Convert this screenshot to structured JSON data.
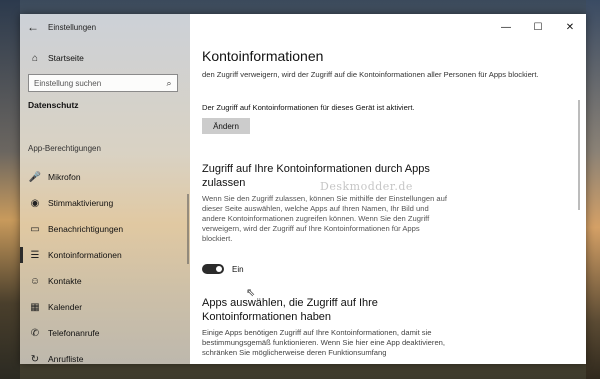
{
  "window": {
    "app_title": "Einstellungen",
    "back_icon": "←",
    "caption": {
      "minimize": "—",
      "maximize": "☐",
      "close": "✕"
    }
  },
  "sidebar": {
    "home": {
      "icon": "⌂",
      "label": "Startseite"
    },
    "search": {
      "placeholder": "Einstellung suchen",
      "icon": "⌕"
    },
    "section_title": "Datenschutz",
    "group_header": "App-Berechtigungen",
    "items": [
      {
        "icon": "🎤",
        "label": "Mikrofon"
      },
      {
        "icon": "◉",
        "label": "Stimmaktivierung"
      },
      {
        "icon": "▭",
        "label": "Benachrichtigungen"
      },
      {
        "icon": "☰",
        "label": "Kontoinformationen",
        "selected": true
      },
      {
        "icon": "☺",
        "label": "Kontakte"
      },
      {
        "icon": "▦",
        "label": "Kalender"
      },
      {
        "icon": "✆",
        "label": "Telefonanrufe"
      },
      {
        "icon": "↻",
        "label": "Anrufliste"
      }
    ]
  },
  "main": {
    "title": "Kontoinformationen",
    "intro_text": "den Zugriff verweigern, wird der Zugriff auf die Kontoinformationen aller Personen für Apps blockiert.",
    "status_text": "Der Zugriff auf Kontoinformationen für dieses Gerät ist aktiviert.",
    "change_button": "Ändern",
    "apps_access_heading": "Zugriff auf Ihre Kontoinformationen durch Apps zulassen",
    "apps_access_text": "Wenn Sie den Zugriff zulassen, können Sie mithilfe der Einstellungen auf dieser Seite auswählen, welche Apps auf Ihren Namen, Ihr Bild und andere Kontoinformationen zugreifen können. Wenn Sie den Zugriff verweigern, wird der Zugriff auf Ihre Kontoinformationen für Apps blockiert.",
    "toggle": {
      "state": "Ein",
      "on": true
    },
    "choose_apps_heading": "Apps auswählen, die Zugriff auf Ihre Kontoinformationen haben",
    "choose_apps_text": "Einige Apps benötigen Zugriff auf Ihre Kontoinformationen, damit sie bestimmungsgemäß funktionieren. Wenn Sie hier eine App deaktivieren, schränken Sie möglicherweise deren Funktionsumfang",
    "watermark": "Deskmodder.de"
  }
}
